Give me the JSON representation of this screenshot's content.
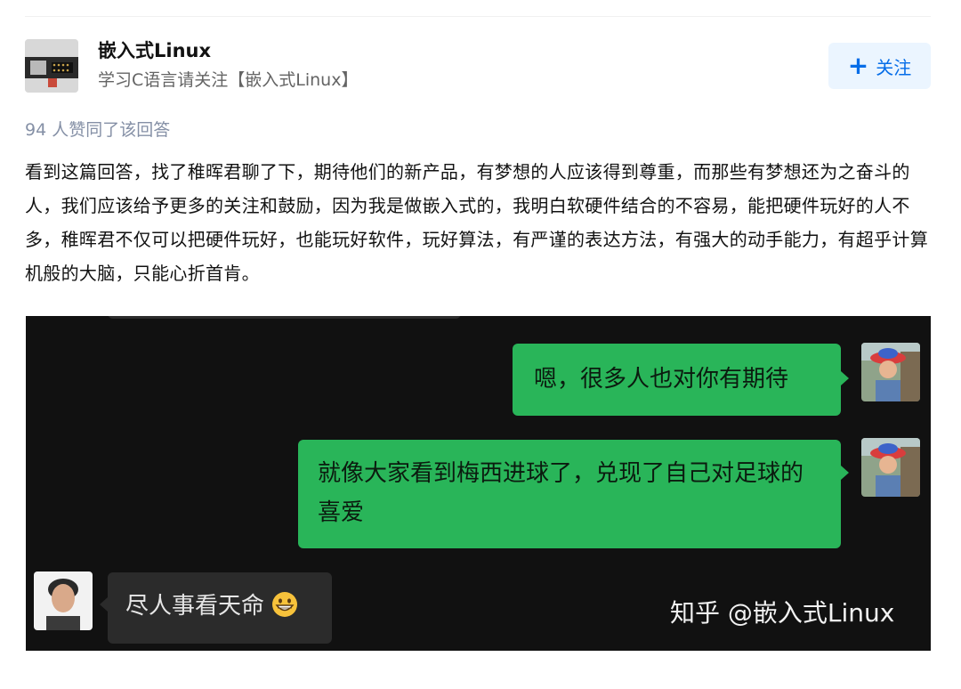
{
  "author": {
    "name": "嵌入式Linux",
    "bio": "学习C语言请关注【嵌入式Linux】",
    "follow_label": "关注"
  },
  "answer": {
    "voters": "94 人赞同了该回答",
    "text": "看到这篇回答，找了稚晖君聊了下，期待他们的新产品，有梦想的人应该得到尊重，而那些有梦想还为之奋斗的人，我们应该给予更多的关注和鼓励，因为我是做嵌入式的，我明白软硬件结合的不容易，能把硬件玩好的人不多，稚晖君不仅可以把硬件玩好，也能玩好软件，玩好算法，有严谨的表达方法，有强大的动手能力，有超乎计算机般的大脑，只能心折首肯。"
  },
  "chat": {
    "messages": [
      {
        "side": "right",
        "text": "嗯，很多人也对你有期待"
      },
      {
        "side": "right",
        "text": "就像大家看到梅西进球了，兑现了自己对足球的喜爱"
      },
      {
        "side": "left",
        "text": "尽人事看天命",
        "emoji": "grinning-face-icon"
      }
    ],
    "watermark": "知乎 @嵌入式Linux"
  },
  "colors": {
    "accent": "#056de8",
    "follow_bg": "#ebf5ff",
    "sent_bubble": "#29b559",
    "received_bubble": "#2b2b2b",
    "chat_bg": "#111111"
  }
}
